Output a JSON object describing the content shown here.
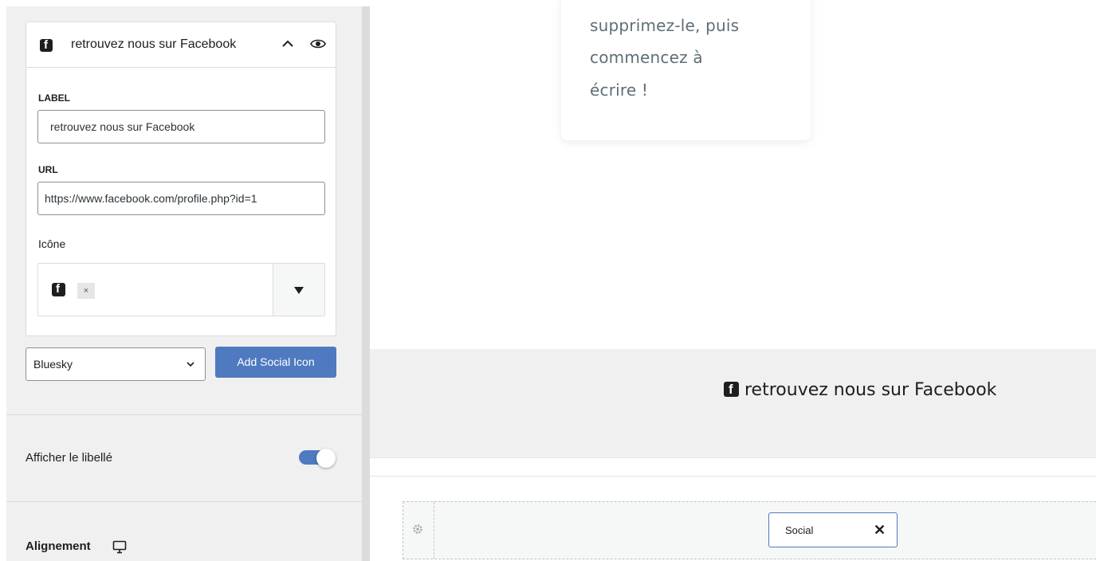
{
  "social_item": {
    "title": "retrouvez nous sur Facebook",
    "label_field": {
      "label": "LABEL",
      "value": "retrouvez nous sur Facebook"
    },
    "url_field": {
      "label": "URL",
      "value": "https://www.facebook.com/profile.php?id=1"
    },
    "icon_field": {
      "label": "Icône",
      "selected_icon": "facebook-icon",
      "remove_symbol": "×"
    }
  },
  "add_social": {
    "select_value": "Bluesky",
    "button_label": "Add Social Icon"
  },
  "show_label": {
    "label": "Afficher le libellé",
    "enabled": true
  },
  "alignment": {
    "label": "Alignement",
    "device_icon": "monitor-icon"
  },
  "preview": {
    "paragraph_lines": [
      "supprimez-le, puis",
      "commencez à",
      "écrire !"
    ],
    "social_link_text": "retrouvez nous sur Facebook",
    "builder_chip_label": "Social",
    "builder_chip_close": "✕"
  },
  "colors": {
    "accent": "#4f7ac0",
    "panel_bg": "#f0f0f1",
    "text_muted": "#5e6e77"
  }
}
